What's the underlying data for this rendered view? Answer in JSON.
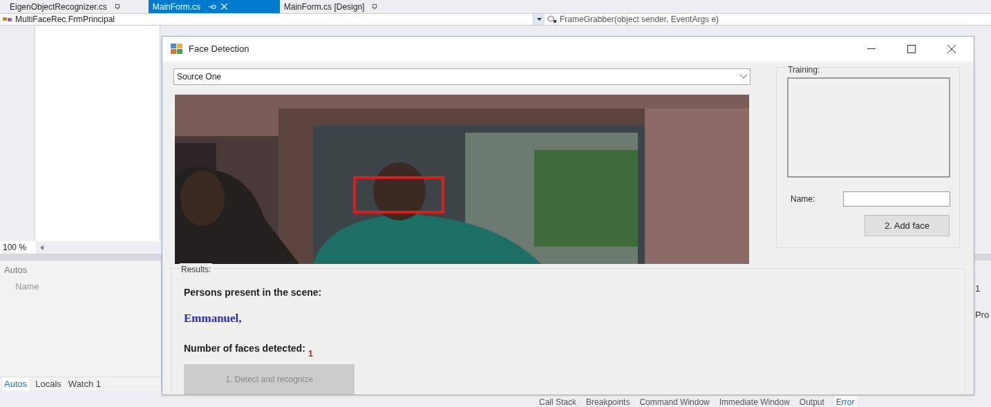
{
  "editor_tabs": [
    {
      "label": "EigenObjectRecognizer.cs",
      "selected": false
    },
    {
      "label": "MainForm.cs",
      "selected": true
    },
    {
      "label": "MainForm.cs [Design]",
      "selected": false
    }
  ],
  "navigation_bar": {
    "type_dropdown": "MultiFaceRec.FrmPrincipal",
    "member_dropdown": "FrameGrabber(object sender, EventArgs e)"
  },
  "zoom_level": "100 %",
  "autos_panel": {
    "title": "Autos",
    "columns": [
      "Name"
    ]
  },
  "right_panel_fragments": [
    "1",
    "Pro"
  ],
  "debug_tabs": [
    {
      "label": "Autos",
      "selected": true
    },
    {
      "label": "Locals",
      "selected": false
    },
    {
      "label": "Watch 1",
      "selected": false
    }
  ],
  "output_tabs": [
    {
      "label": "Call Stack",
      "selected": false
    },
    {
      "label": "Breakpoints",
      "selected": false
    },
    {
      "label": "Command Window",
      "selected": false
    },
    {
      "label": "Immediate Window",
      "selected": false
    },
    {
      "label": "Output",
      "selected": false
    },
    {
      "label": "Error",
      "selected": true
    }
  ],
  "form": {
    "title": "Face Detection",
    "source_dropdown": "Source One",
    "training": {
      "title": "Training:",
      "name_label": "Name:",
      "button": "2. Add face"
    },
    "results": {
      "title": "Results:",
      "persons_label": "Persons present in the scene:",
      "persons_value": "Emmanuel,",
      "faces_label": "Number of faces detected:",
      "faces_value": "1",
      "detect_button": {
        "label": "1. Detect and recognize",
        "disabled": true
      }
    }
  }
}
